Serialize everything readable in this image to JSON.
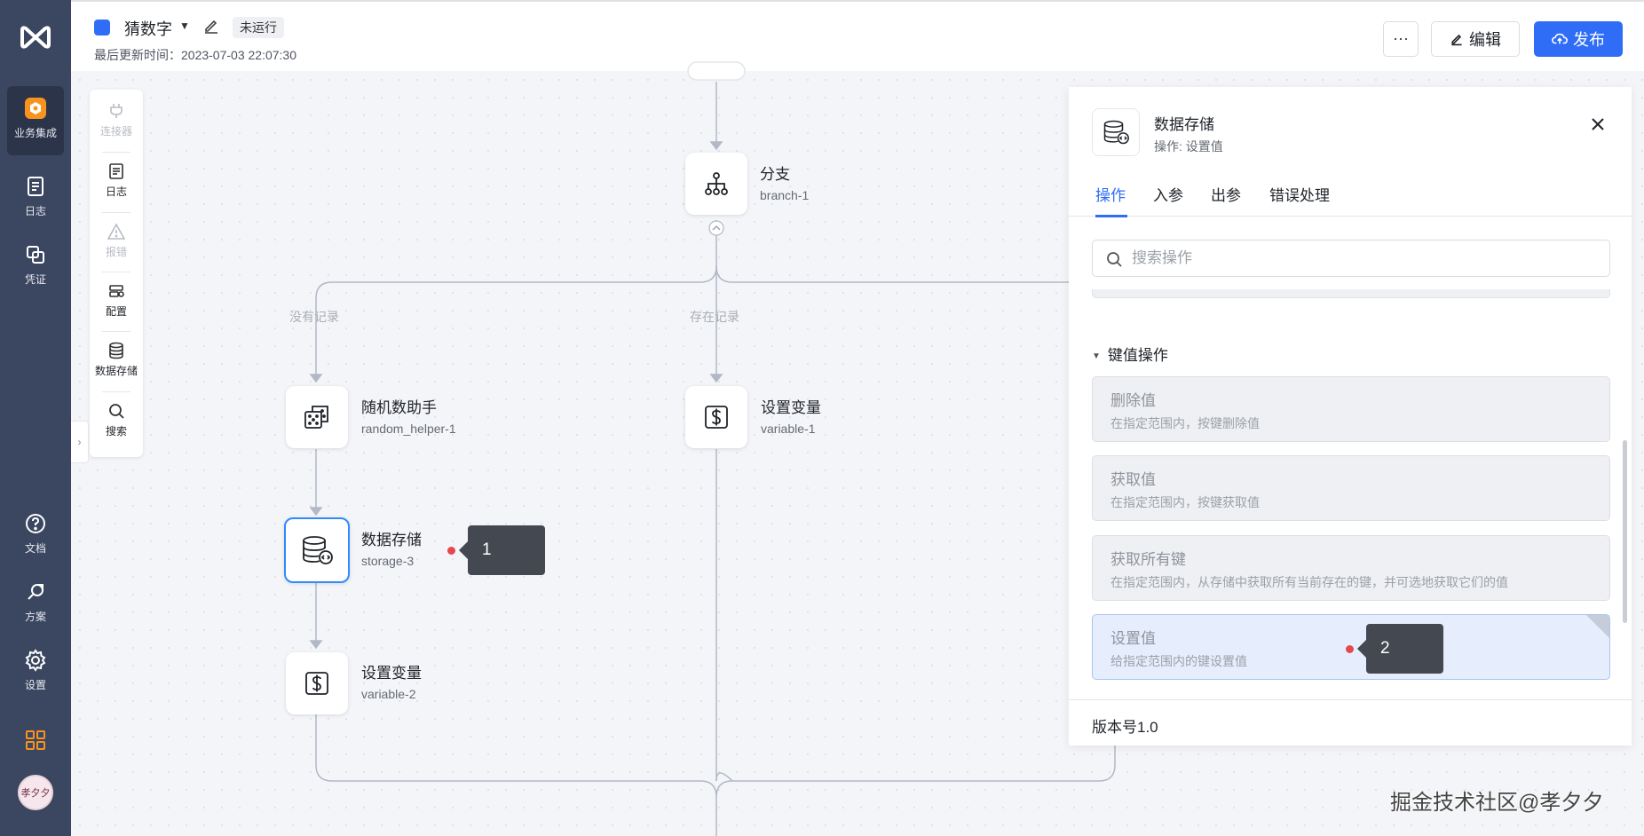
{
  "nav": {
    "items": [
      {
        "label": "业务集成",
        "icon": "integration-icon",
        "active": true
      },
      {
        "label": "日志",
        "icon": "log-icon"
      },
      {
        "label": "凭证",
        "icon": "credential-icon"
      },
      {
        "label": "文档",
        "icon": "help-icon"
      },
      {
        "label": "方案",
        "icon": "solution-icon"
      },
      {
        "label": "设置",
        "icon": "settings-icon"
      }
    ],
    "apps_icon": "apps-grid-icon",
    "avatar_text": "孝夕夕"
  },
  "header": {
    "title": "猜数字",
    "status_badge": "未运行",
    "updated": "最后更新时间：2023-07-03 22:07:30",
    "more_label": "···",
    "edit_label": "编辑",
    "publish_label": "发布"
  },
  "tools": [
    {
      "label": "连接器",
      "icon": "plug-icon",
      "disabled": true
    },
    {
      "label": "日志",
      "icon": "log-icon",
      "disabled": false
    },
    {
      "label": "报错",
      "icon": "warning-icon",
      "disabled": true
    },
    {
      "label": "配置",
      "icon": "config-icon",
      "disabled": false
    },
    {
      "label": "数据存储",
      "icon": "database-icon",
      "disabled": false
    },
    {
      "label": "搜索",
      "icon": "search-icon",
      "disabled": false
    }
  ],
  "flow": {
    "branch": {
      "title": "分支",
      "id": "branch-1"
    },
    "edge_labels": {
      "left": "没有记录",
      "right": "存在记录"
    },
    "random": {
      "title": "随机数助手",
      "id": "random_helper-1"
    },
    "storage": {
      "title": "数据存储",
      "id": "storage-3"
    },
    "var2": {
      "title": "设置变量",
      "id": "variable-2"
    },
    "var1": {
      "title": "设置变量",
      "id": "variable-1"
    },
    "callout1": "1",
    "callout2": "2"
  },
  "panel": {
    "title": "数据存储",
    "subtitle": "操作: 设置值",
    "tabs": [
      "操作",
      "入参",
      "出参",
      "错误处理"
    ],
    "active_tab": 0,
    "search_placeholder": "搜索操作",
    "section_title": "键值操作",
    "operations": [
      {
        "name": "删除值",
        "desc": "在指定范围内，按键删除值"
      },
      {
        "name": "获取值",
        "desc": "在指定范围内，按键获取值"
      },
      {
        "name": "获取所有键",
        "desc": "在指定范围内，从存储中获取所有当前存在的键，并可选地获取它们的值"
      },
      {
        "name": "设置值",
        "desc": "给指定范围内的键设置值",
        "selected": true
      }
    ],
    "version": "版本号1.0"
  },
  "watermark": "掘金技术社区@孝夕夕",
  "colors": {
    "nav_bg": "#3b4660",
    "primary": "#2f6df6",
    "selected_border": "#2f8bff",
    "callout_bg": "#444851",
    "dot": "#e5484d"
  }
}
